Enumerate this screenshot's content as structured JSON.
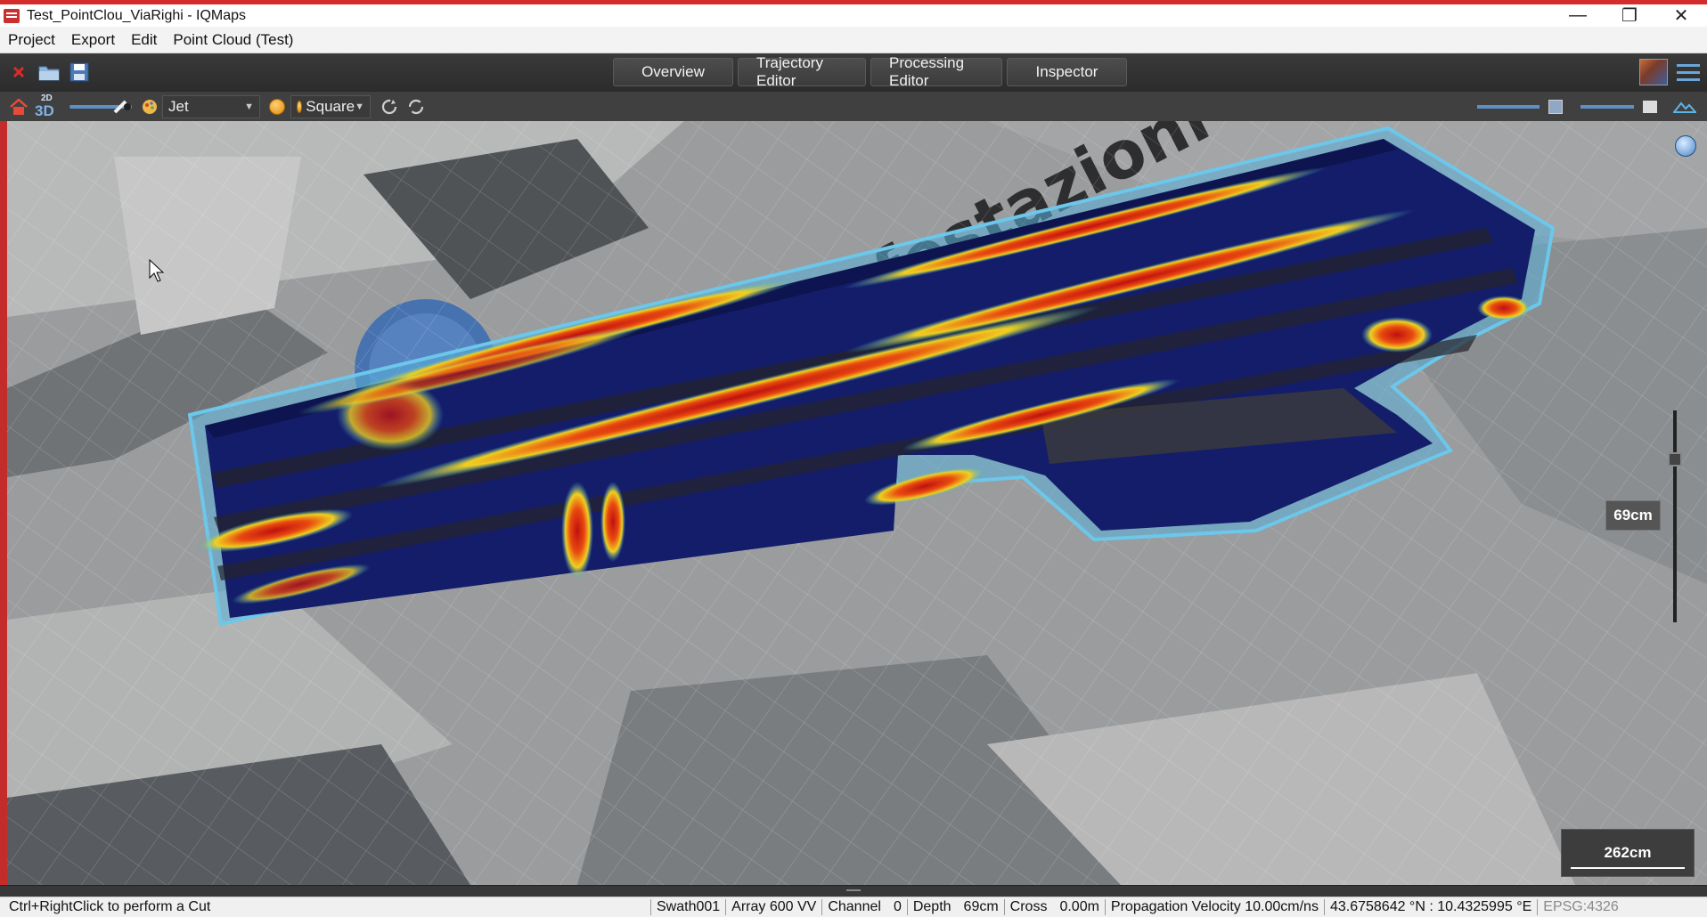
{
  "window": {
    "title": "Test_PointClou_ViaRighi  - IQMaps",
    "controls": [
      "—",
      "❐",
      "✕"
    ]
  },
  "menu": [
    "Project",
    "Export",
    "Edit",
    "Point Cloud (Test)"
  ],
  "tabs": [
    "Overview",
    "Trajectory Editor",
    "Processing Editor",
    "Inspector"
  ],
  "toolbar2": {
    "mode_label": "3D",
    "mode_sub": "2D",
    "colormap": "Jet",
    "point_shape": "Square"
  },
  "viewport": {
    "map_text": "festazioni",
    "depth_label": "69cm",
    "scale_label": "262cm",
    "cut_color": "#3b73c6"
  },
  "status": {
    "hint": "Ctrl+RightClick to perform a Cut",
    "swath": "Swath001",
    "array": "Array 600 VV",
    "channel_label": "Channel",
    "channel_value": "0",
    "depth_label": "Depth",
    "depth_value": "69cm",
    "cross_label": "Cross",
    "cross_value": "0.00m",
    "velocity": "Propagation Velocity 10.00cm/ns",
    "coords": "43.6758642 °N : 10.4325995 °E",
    "epsg": "EPSG:4326"
  }
}
